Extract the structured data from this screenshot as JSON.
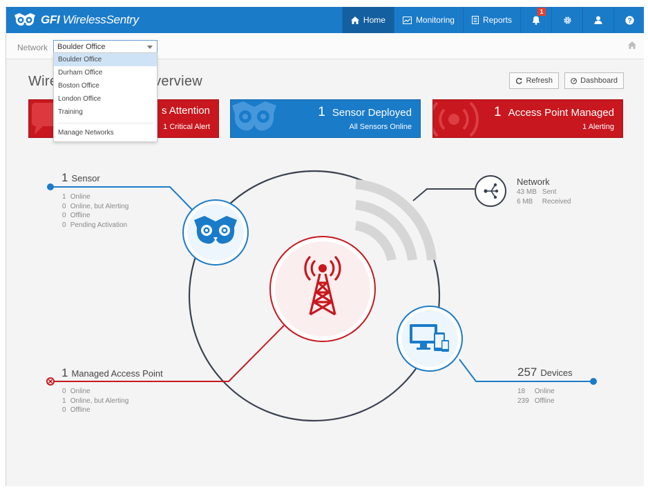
{
  "brand": {
    "name_bold": "GFI",
    "name_rest": "WirelessSentry"
  },
  "nav": {
    "home": "Home",
    "monitoring": "Monitoring",
    "reports": "Reports",
    "alerts_badge": "1"
  },
  "subbar": {
    "network_label": "Network",
    "selected_network": "Boulder Office"
  },
  "dropdown": {
    "options": [
      "Boulder Office",
      "Durham Office",
      "Boston Office",
      "London Office",
      "Training"
    ],
    "manage": "Manage Networks"
  },
  "page": {
    "title": "Wireless Network Overview"
  },
  "buttons": {
    "refresh": "Refresh",
    "dashboard": "Dashboard"
  },
  "cards": {
    "attention": {
      "title": "s Attention",
      "sub": "1 Critical Alert"
    },
    "sensor": {
      "num": "1",
      "title": "Sensor Deployed",
      "sub": "All Sensors Online"
    },
    "access_point": {
      "num": "1",
      "title": "Access Point Managed",
      "sub": "1 Alerting"
    }
  },
  "sensor_stats": {
    "count": "1",
    "label": "Sensor",
    "lines": [
      {
        "n": "1",
        "t": "Online"
      },
      {
        "n": "0",
        "t": "Online, but Alerting"
      },
      {
        "n": "0",
        "t": "Offline"
      },
      {
        "n": "0",
        "t": "Pending Activation"
      }
    ]
  },
  "network_stats": {
    "label": "Network",
    "lines": [
      {
        "n": "43 MB",
        "t": "Sent"
      },
      {
        "n": "6 MB",
        "t": "Received"
      }
    ]
  },
  "ap_stats": {
    "count": "1",
    "label": "Managed Access Point",
    "lines": [
      {
        "n": "0",
        "t": "Online"
      },
      {
        "n": "1",
        "t": "Online, but Alerting"
      },
      {
        "n": "0",
        "t": "Offline"
      }
    ]
  },
  "device_stats": {
    "count": "257",
    "label": "Devices",
    "lines": [
      {
        "n": "18",
        "t": "Online"
      },
      {
        "n": "239",
        "t": "Offline"
      }
    ]
  },
  "colors": {
    "brand_blue": "#1a7bc9",
    "alert_red": "#c8171e",
    "line_dark": "#3a4150"
  }
}
